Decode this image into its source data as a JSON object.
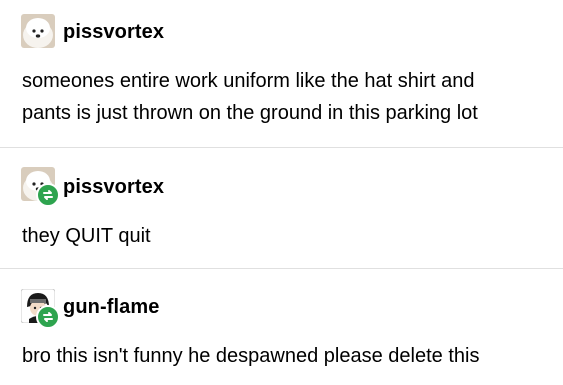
{
  "posts": [
    {
      "username": "pissvortex",
      "body": [
        "someones entire work uniform like the hat shirt and",
        "pants is just thrown on the ground in this parking lot"
      ],
      "avatar": "white-dog-avatar",
      "reblogged": false
    },
    {
      "username": "pissvortex",
      "body": [
        "they QUIT quit"
      ],
      "avatar": "white-dog-avatar",
      "reblogged": true
    },
    {
      "username": "gun-flame",
      "body": [
        "bro this isn't funny he despawned please delete this"
      ],
      "avatar": "anime-character-avatar",
      "reblogged": true
    }
  ],
  "colors": {
    "text": "#000000",
    "divider": "#e0e0e0",
    "reblog_badge": "#2ea44f"
  },
  "icons": {
    "reblog": "reblog-icon"
  }
}
